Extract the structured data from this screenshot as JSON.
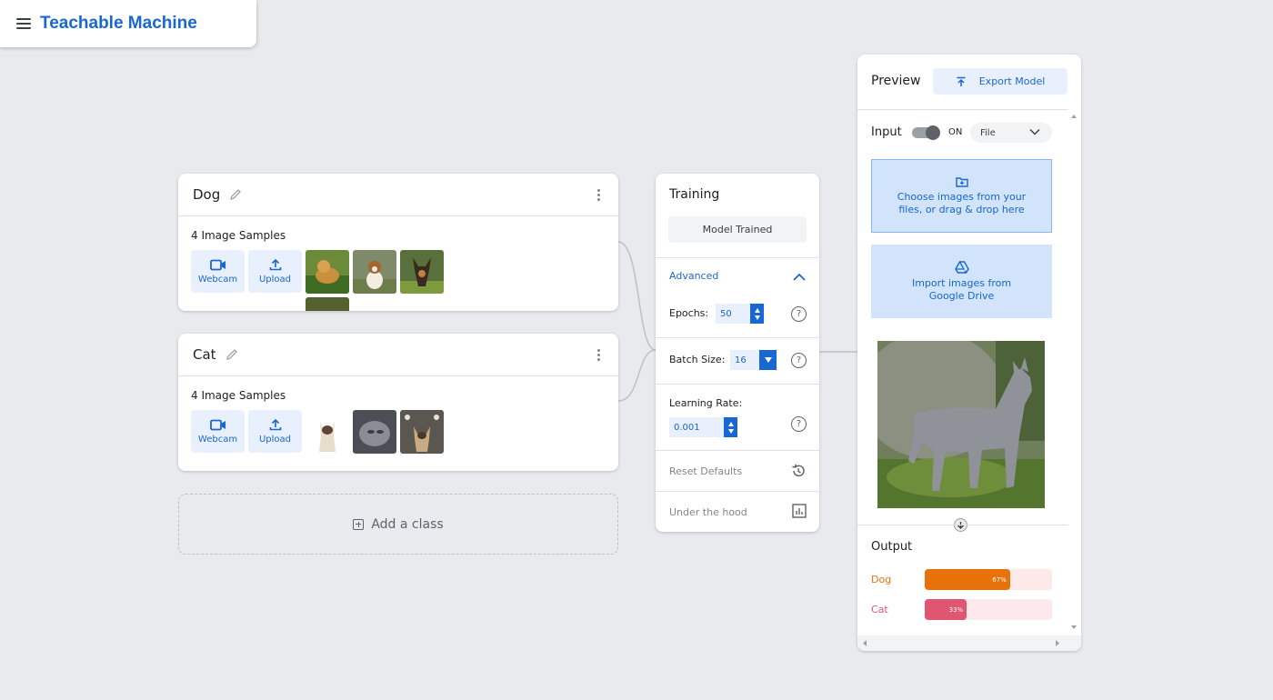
{
  "app": {
    "title": "Teachable Machine"
  },
  "classes": [
    {
      "name": "Dog",
      "samples_label": "4 Image Samples",
      "webcam_label": "Webcam",
      "upload_label": "Upload"
    },
    {
      "name": "Cat",
      "samples_label": "4 Image Samples",
      "webcam_label": "Webcam",
      "upload_label": "Upload"
    }
  ],
  "add_class_label": "Add a class",
  "training": {
    "title": "Training",
    "status_button": "Model Trained",
    "advanced_label": "Advanced",
    "epochs_label": "Epochs:",
    "epochs_value": "50",
    "batch_label": "Batch Size:",
    "batch_value": "16",
    "lr_label": "Learning Rate:",
    "lr_value": "0.001",
    "reset_label": "Reset Defaults",
    "hood_label": "Under the hood"
  },
  "preview": {
    "title": "Preview",
    "export_label": "Export Model",
    "input_label": "Input",
    "toggle_state": "ON",
    "source_value": "File",
    "choose_files": "Choose images from your files, or drag & drop here",
    "import_drive": "Import images from Google Drive",
    "output_label": "Output",
    "results": [
      {
        "label": "Dog",
        "percent": 67,
        "percent_text": "67%",
        "color": "#e8710a",
        "bg": "#fde9e7"
      },
      {
        "label": "Cat",
        "percent": 33,
        "percent_text": "33%",
        "color": "#e0556f",
        "bg": "#fde9ec"
      }
    ]
  },
  "colors": {
    "accent": "#1967d2",
    "background": "#e8eaed"
  }
}
